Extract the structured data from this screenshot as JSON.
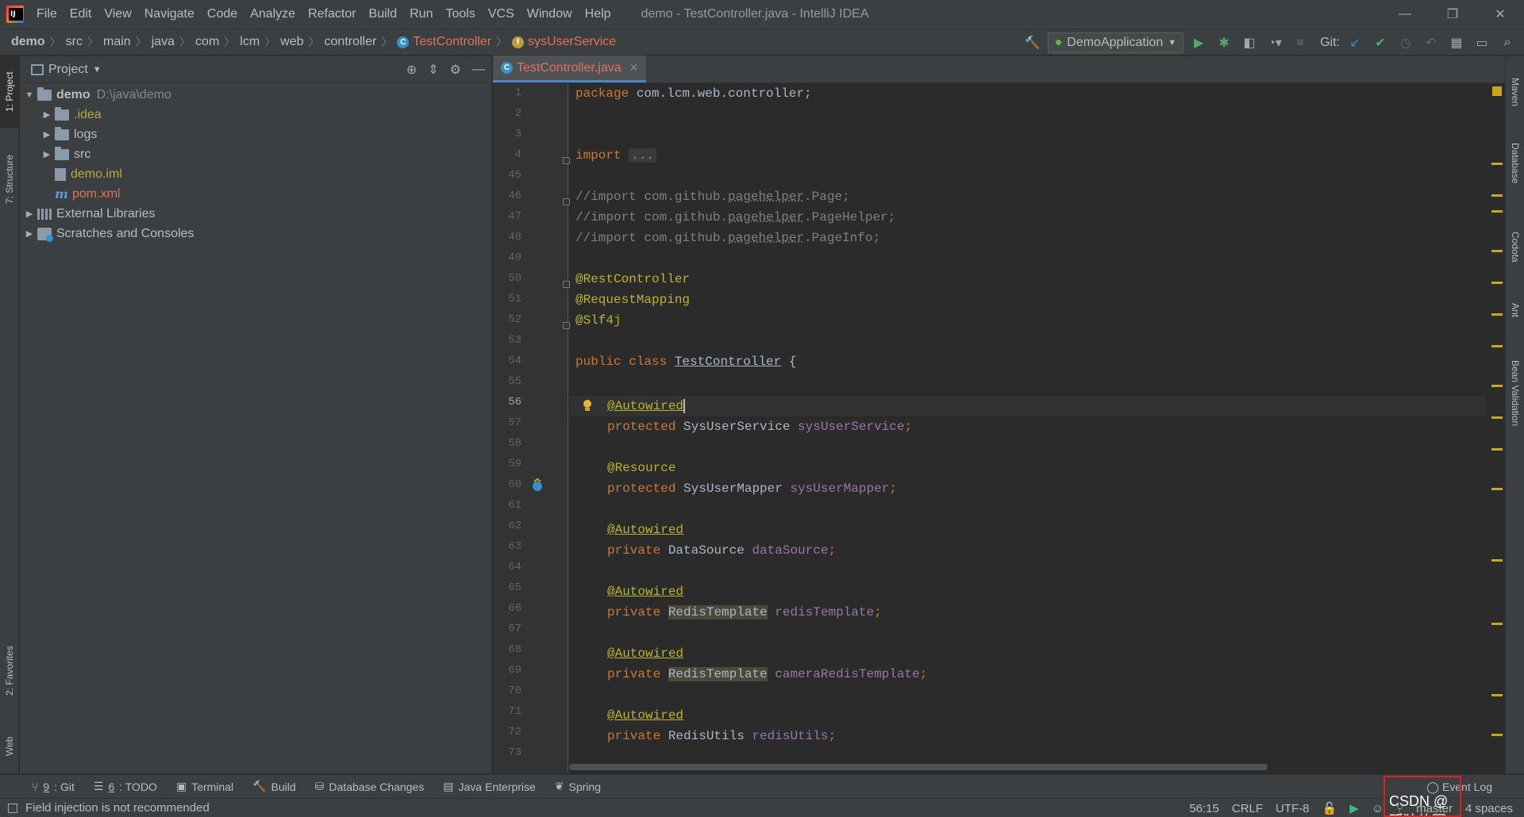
{
  "menu": [
    "File",
    "Edit",
    "View",
    "Navigate",
    "Code",
    "Analyze",
    "Refactor",
    "Build",
    "Run",
    "Tools",
    "VCS",
    "Window",
    "Help"
  ],
  "window_title": "demo - TestController.java - IntelliJ IDEA",
  "breadcrumbs": [
    "demo",
    "src",
    "main",
    "java",
    "com",
    "lcm",
    "web",
    "controller",
    "TestController",
    "sysUserService"
  ],
  "toolbar": {
    "run_config": "DemoApplication",
    "git_label": "Git:"
  },
  "left_stripe": {
    "project": "1: Project",
    "structure": "7: Structure",
    "favorites": "2: Favorites",
    "web": "Web"
  },
  "right_stripe": {
    "maven": "Maven",
    "database": "Database",
    "codota": "Codota",
    "ant": "Ant",
    "bean_validation": "Bean Validation"
  },
  "project_panel": {
    "title": "Project",
    "tree": [
      {
        "label": "demo",
        "path": "D:\\java\\demo"
      },
      {
        "label": ".idea"
      },
      {
        "label": "logs"
      },
      {
        "label": "src"
      },
      {
        "label": "demo.iml"
      },
      {
        "label": "pom.xml"
      },
      {
        "label": "External Libraries"
      },
      {
        "label": "Scratches and Consoles"
      }
    ]
  },
  "editor": {
    "tab_name": "TestController.java",
    "line_numbers": [
      "1",
      "2",
      "3",
      "4",
      "45",
      "46",
      "47",
      "48",
      "49",
      "50",
      "51",
      "52",
      "53",
      "54",
      "55",
      "56",
      "57",
      "58",
      "59",
      "60",
      "61",
      "62",
      "63",
      "64",
      "65",
      "66",
      "67",
      "68",
      "69",
      "70",
      "71",
      "72",
      "73"
    ],
    "code": {
      "l1_kw": "package",
      "l1_rest": " com.lcm.web.controller;",
      "l4_kw": "import",
      "l4_dots": "...",
      "l46_a": "//import com.github.",
      "l46_b": "pagehelper",
      "l46_c": ".Page;",
      "l47_a": "//import com.github.",
      "l47_b": "pagehelper",
      "l47_c": ".PageHelper;",
      "l48_a": "//import com.github.",
      "l48_b": "pagehelper",
      "l48_c": ".PageInfo;",
      "l50": "@RestController",
      "l51": "@RequestMapping",
      "l52": "@Slf4j",
      "l54_kw": "public class",
      "l54_cls": "TestController",
      "l54_rest": " {",
      "autowired": "@Autowired",
      "resource": "@Resource",
      "protected_kw": "protected",
      "private_kw": "private",
      "l57_type": " SysUserService ",
      "l57_field": "sysUserService",
      "semi": ";",
      "l60_type": " SysUserMapper ",
      "l60_field": "sysUserMapper",
      "l63_type": " DataSource ",
      "l63_field": "dataSource",
      "redis_type": "RedisTemplate",
      "l66_field": "redisTemplate",
      "l69_field": "cameraRedisTemplate",
      "l72_type": " RedisUtils ",
      "l72_field": "redisUtils"
    }
  },
  "bottom_tabs": [
    {
      "prefix": "9",
      "label": ": Git"
    },
    {
      "prefix": "6",
      "label": ": TODO"
    },
    {
      "label": "Terminal"
    },
    {
      "label": "Build"
    },
    {
      "label": "Database Changes"
    },
    {
      "label": "Java Enterprise"
    },
    {
      "label": "Spring"
    }
  ],
  "event_log": "Event Log",
  "status": {
    "message": "Field injection is not recommended",
    "position": "56:15",
    "line_sep": "CRLF",
    "encoding": "UTF-8",
    "branch": "master",
    "indent": "4 spaces"
  },
  "watermark": "CSDN @孤独的圆"
}
